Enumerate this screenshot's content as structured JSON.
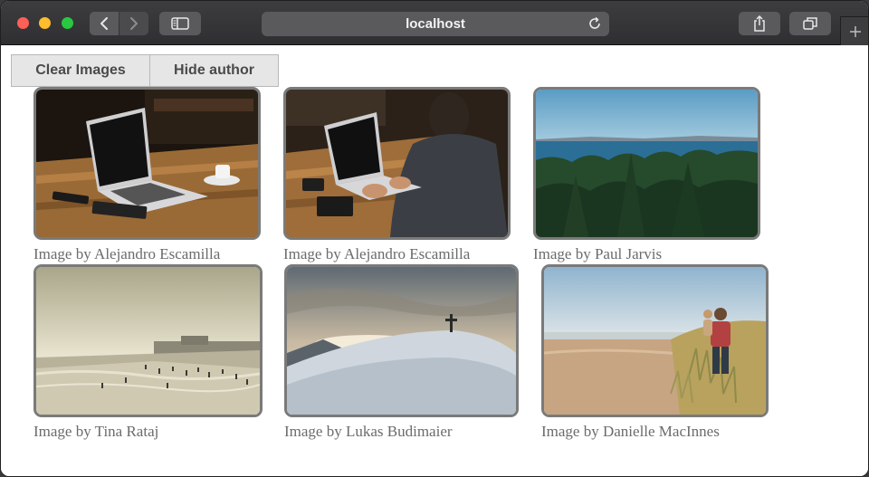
{
  "browser": {
    "address": "localhost"
  },
  "toolbar": {
    "clear_label": "Clear Images",
    "hide_label": "Hide author"
  },
  "gallery": [
    {
      "caption": "Image by Alejandro Escamilla",
      "subject": "laptop-on-wooden-table"
    },
    {
      "caption": "Image by Alejandro Escamilla",
      "subject": "man-typing-on-laptop"
    },
    {
      "caption": "Image by Paul Jarvis",
      "subject": "forest-and-sea"
    },
    {
      "caption": "Image by Tina Rataj",
      "subject": "crowded-beach"
    },
    {
      "caption": "Image by Lukas Budimaier",
      "subject": "snowy-mountain-cross"
    },
    {
      "caption": "Image by Danielle MacInnes",
      "subject": "father-and-child-on-beach"
    }
  ],
  "colors": {
    "traffic_red": "#fe5f57",
    "traffic_yellow": "#febc2e",
    "traffic_green": "#28c840",
    "frame_border": "#7a7a7a",
    "caption_text": "#6b6b6b"
  }
}
